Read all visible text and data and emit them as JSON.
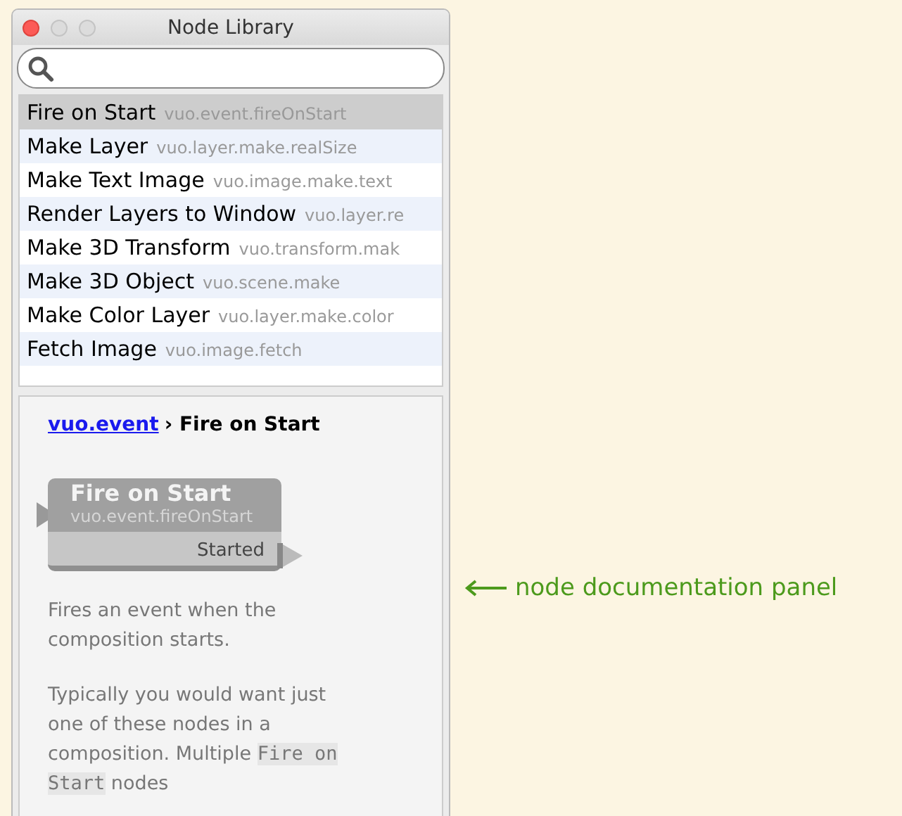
{
  "window": {
    "title": "Node Library"
  },
  "nodes": [
    {
      "name": "Fire on Start",
      "id": "vuo.event.fireOnStart",
      "selected": true
    },
    {
      "name": "Make Layer",
      "id": "vuo.layer.make.realSize",
      "selected": false
    },
    {
      "name": "Make Text Image",
      "id": "vuo.image.make.text",
      "selected": false
    },
    {
      "name": "Render Layers to Window",
      "id": "vuo.layer.re",
      "selected": false
    },
    {
      "name": "Make 3D Transform",
      "id": "vuo.transform.mak",
      "selected": false
    },
    {
      "name": "Make 3D Object",
      "id": "vuo.scene.make",
      "selected": false
    },
    {
      "name": "Make Color Layer",
      "id": "vuo.layer.make.color",
      "selected": false
    },
    {
      "name": "Fetch Image",
      "id": "vuo.image.fetch",
      "selected": false
    }
  ],
  "documentation": {
    "breadcrumb_link": "vuo.event",
    "breadcrumb_separator": "›",
    "breadcrumb_current": "Fire on Start",
    "node": {
      "title": "Fire on Start",
      "class_name": "vuo.event.fireOnStart",
      "output_port": "Started"
    },
    "paragraphs": [
      {
        "text": "Fires an event when the composition starts."
      },
      {
        "text": "Typically you would want just one of these nodes in a composition. Multiple",
        "code": "Fire on Start",
        "text_after": "nodes"
      }
    ]
  },
  "annotation": {
    "text": "node documentation panel"
  }
}
